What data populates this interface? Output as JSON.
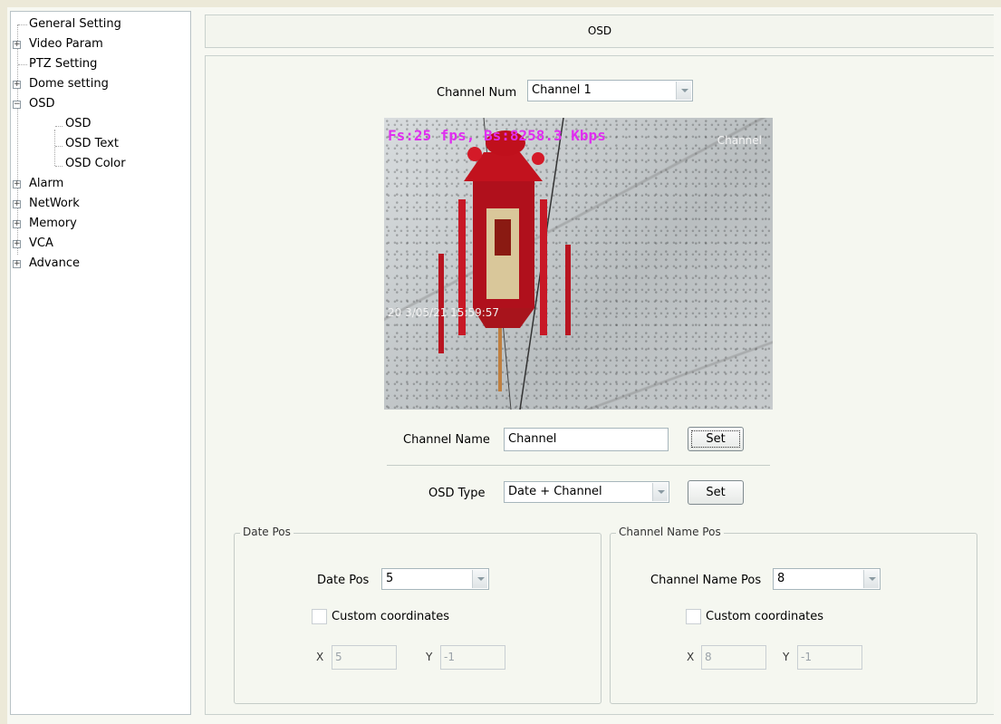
{
  "tree": {
    "items": [
      {
        "label": "General Setting",
        "expander": ""
      },
      {
        "label": "Video Param",
        "expander": "+"
      },
      {
        "label": "PTZ Setting",
        "expander": ""
      },
      {
        "label": "Dome setting",
        "expander": "+"
      },
      {
        "label": "OSD",
        "expander": "−"
      },
      {
        "label": "OSD",
        "expander": ""
      },
      {
        "label": "OSD Text",
        "expander": ""
      },
      {
        "label": "OSD Color",
        "expander": ""
      },
      {
        "label": "Alarm",
        "expander": "+"
      },
      {
        "label": "NetWork",
        "expander": "+"
      },
      {
        "label": "Memory",
        "expander": "+"
      },
      {
        "label": "VCA",
        "expander": "+"
      },
      {
        "label": "Advance",
        "expander": "+"
      }
    ]
  },
  "header": {
    "title": "OSD"
  },
  "channel_num": {
    "label": "Channel Num",
    "value": "Channel  1"
  },
  "video": {
    "stats_overlay": "Fs:25 fps, Bs:8258.3 Kbps",
    "channel_overlay": "Channel",
    "date_overlay": "20 3/05/21 15:59:57"
  },
  "channel_name": {
    "label": "Channel Name",
    "value": "Channel",
    "set_label": "Set"
  },
  "osd_type": {
    "label": "OSD Type",
    "value": "Date + Channel",
    "set_label": "Set"
  },
  "date_pos_group": {
    "title": "Date Pos",
    "pos_label": "Date Pos",
    "pos_value": "5",
    "custom_label": "Custom coordinates",
    "x_label": "X",
    "x_value": "5",
    "y_label": "Y",
    "y_value": "-1"
  },
  "channel_name_pos_group": {
    "title": "Channel Name Pos",
    "pos_label": "Channel Name Pos",
    "pos_value": "8",
    "custom_label": "Custom coordinates",
    "x_label": "X",
    "x_value": "8",
    "y_label": "Y",
    "y_value": "-1"
  },
  "colors": {
    "stats_overlay": "#e02ef0",
    "panel_bg": "#f5f7f0"
  }
}
